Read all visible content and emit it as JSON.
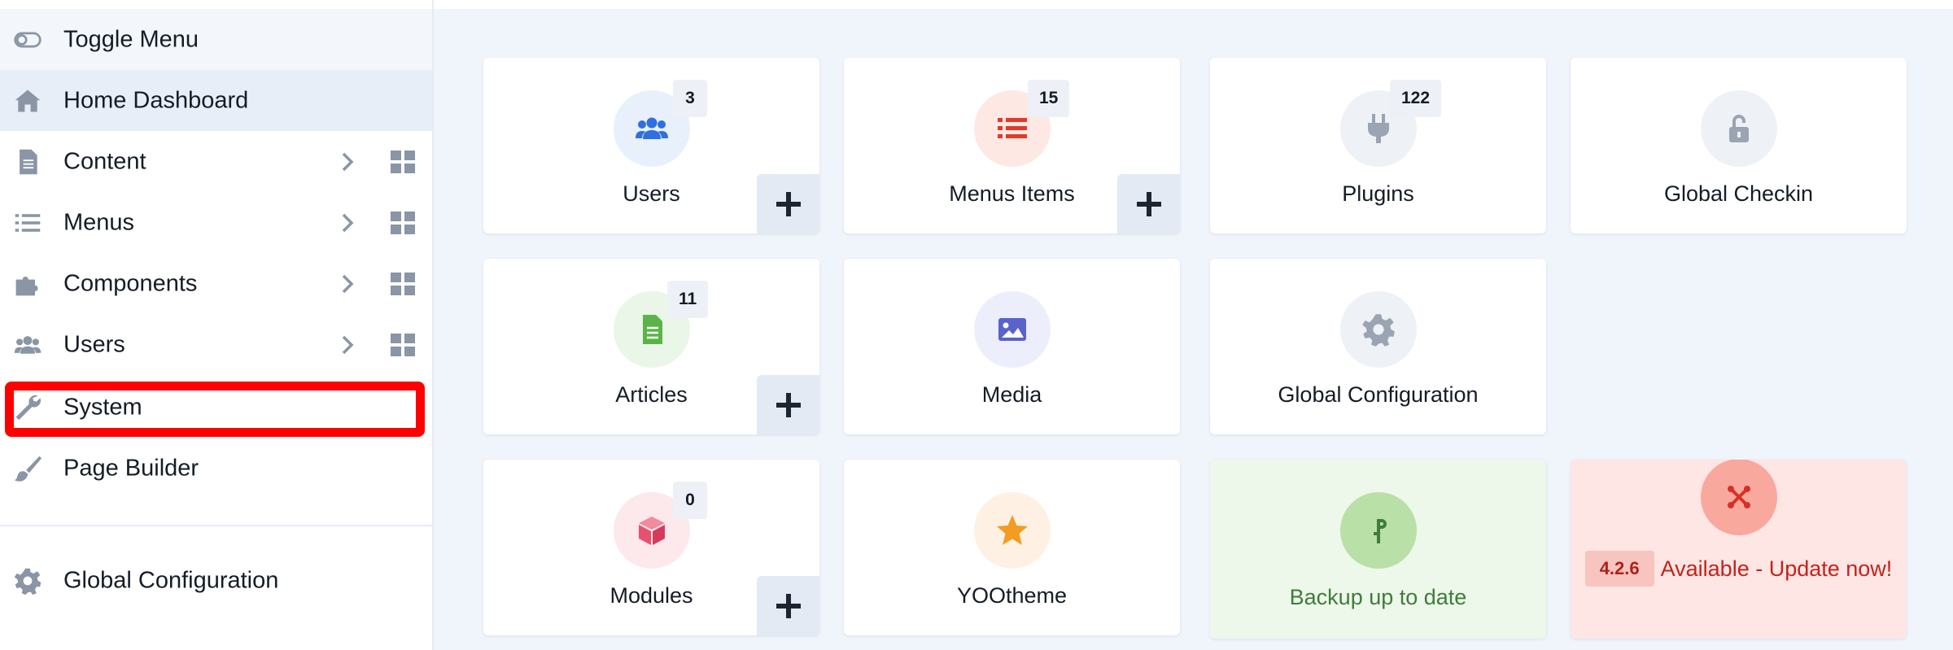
{
  "sidebar": {
    "items": [
      {
        "label": "Toggle Menu",
        "icon": "toggle-icon"
      },
      {
        "label": "Home Dashboard",
        "icon": "home-icon"
      },
      {
        "label": "Content",
        "icon": "file-icon"
      },
      {
        "label": "Menus",
        "icon": "list-icon"
      },
      {
        "label": "Components",
        "icon": "puzzle-icon"
      },
      {
        "label": "Users",
        "icon": "users-icon"
      },
      {
        "label": "System",
        "icon": "wrench-icon"
      },
      {
        "label": "Page Builder",
        "icon": "brush-icon"
      }
    ],
    "global_configuration": "Global Configuration"
  },
  "cards": {
    "users": {
      "title": "Users",
      "count": "3"
    },
    "menus": {
      "title": "Menus Items",
      "count": "15"
    },
    "plugins": {
      "title": "Plugins",
      "count": "122"
    },
    "checkin": {
      "title": "Global Checkin"
    },
    "articles": {
      "title": "Articles",
      "count": "11"
    },
    "media": {
      "title": "Media"
    },
    "global_config": {
      "title": "Global Configuration"
    },
    "modules": {
      "title": "Modules",
      "count": "0"
    },
    "yootheme": {
      "title": "YOOtheme"
    },
    "backup": {
      "title": "Backup up to date"
    },
    "update": {
      "version": "4.2.6",
      "text": "Available - Update now!"
    }
  },
  "colors": {
    "highlight": "#ff0000",
    "users_accent": "#2f6fe0",
    "menus_accent": "#e03a2a",
    "articles_accent": "#5bb44a",
    "media_accent": "#5a63c9",
    "modules_accent": "#e8506f",
    "yootheme_accent": "#f39b22",
    "backup_accent": "#3f7d3a",
    "update_accent": "#c4221c"
  }
}
